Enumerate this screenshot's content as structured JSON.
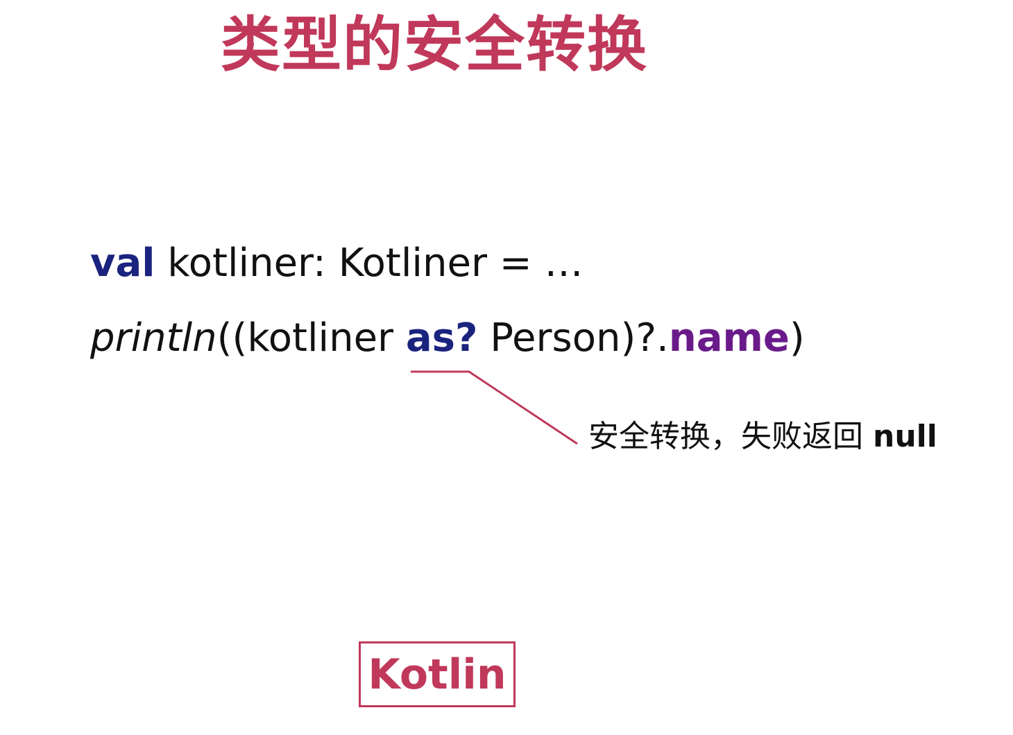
{
  "colors": {
    "accent": "#c0385a",
    "keyword": "#1a237e",
    "property": "#6a1b8a",
    "text": "#111111"
  },
  "title": "类型的安全转换",
  "code": {
    "line1": {
      "keyword": "val",
      "rest": " kotliner: Kotliner = …"
    },
    "line2": {
      "fn": "println",
      "part_a": "((kotliner ",
      "keyword": "as?",
      "part_b": " Person)?.",
      "property": "name",
      "part_c": ")"
    }
  },
  "callout": {
    "text": "安全转换，失败返回 ",
    "null_word": "null"
  },
  "logo": {
    "text": "Kotlin"
  }
}
